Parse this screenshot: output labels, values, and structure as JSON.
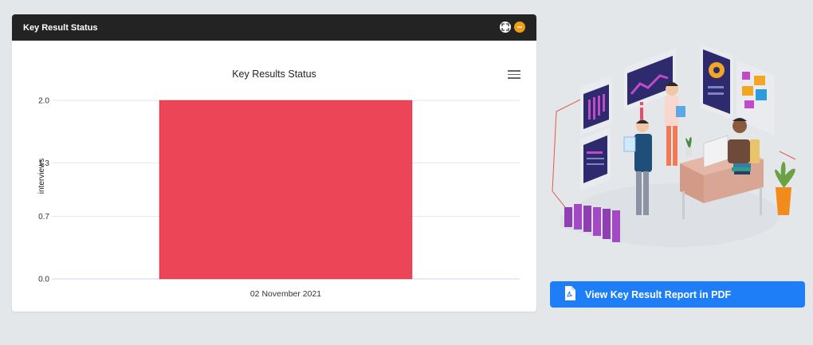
{
  "panel": {
    "title": "Key Result Status"
  },
  "chart_data": {
    "type": "bar",
    "title": "Key Results Status",
    "categories": [
      "02 November 2021"
    ],
    "values": [
      2.0
    ],
    "ylabel": "interviews",
    "xlabel": "",
    "ylim": [
      0,
      2.0
    ],
    "yticks": [
      "0.0",
      "0.7",
      "1.3",
      "2.0"
    ],
    "bar_color": "#ec4558",
    "grid": true
  },
  "report_button": {
    "label": "View Key Result Report in PDF"
  },
  "colors": {
    "header_bg": "#232323",
    "accent_orange": "#f39c12",
    "button_blue": "#1e7ef7"
  }
}
